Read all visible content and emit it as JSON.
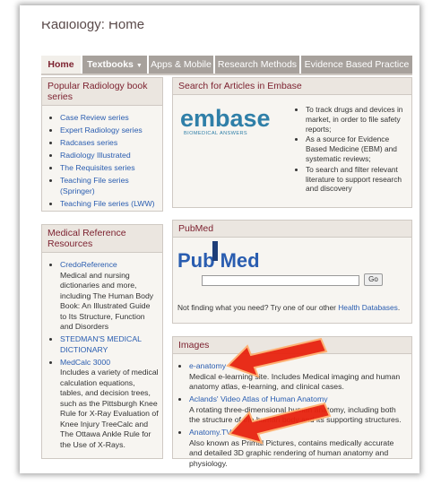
{
  "page": {
    "title": "Radiology: Home"
  },
  "tabs": [
    {
      "label": "Home",
      "active": true
    },
    {
      "label": "Textbooks",
      "dropdown": true
    },
    {
      "label": "Apps & Mobile"
    },
    {
      "label": "Research Methods"
    },
    {
      "label": "Evidence Based Practice"
    }
  ],
  "books": {
    "title": "Popular Radiology book series",
    "items": [
      "Case Review series",
      "Expert Radiology series",
      "Radcases series",
      "Radiology Illustrated",
      "The Requisites series",
      "Teaching File series (Springer)",
      "Teaching File series (LWW)"
    ]
  },
  "reference": {
    "title": "Medical Reference Resources",
    "items": [
      {
        "link": "CredoReference",
        "desc": "Medical and nursing dictionaries and more, including The Human Body Book: An Illustrated Guide to Its Structure, Function and Disorders"
      },
      {
        "link": "STEDMAN'S MEDICAL DICTIONARY",
        "desc": ""
      },
      {
        "link": "MedCalc 3000",
        "desc": "Includes a variety of medical calculation equations, tables, and decision trees, such as the Pittsburgh Knee Rule for X-Ray Evaluation of Knee Injury TreeCalc and The Ottawa Ankle Rule for the Use of X-Rays."
      }
    ]
  },
  "embase": {
    "title": "Search for Articles in Embase",
    "logo_word": "embase",
    "logo_sub": "BIOMEDICAL ANSWERS",
    "points": [
      "To track drugs and devices in market, in order to file safety reports;",
      "As a source for Evidence Based Medicine (EBM) and systematic reviews;",
      "To search and filter relevant literature to support research and discovery"
    ]
  },
  "pubmed": {
    "title": "PubMed",
    "logo_pub": "Pub",
    "logo_med": "Med",
    "go_label": "Go",
    "note_prefix": "Not finding what you need? Try one of our other ",
    "note_link": "Health Databases",
    "note_suffix": "."
  },
  "images": {
    "title": "Images",
    "items": [
      {
        "link": "e-anatomy",
        "desc": "Medical e-learning site. Includes Medical imaging and human anatomy atlas, e-learning, and clinical cases."
      },
      {
        "link": "Aclands' Video Atlas of Human Anatomy",
        "desc": "A rotating three-dimensional human anatomy, including both the structure of the human body and its supporting structures."
      },
      {
        "link": "Anatomy.TV",
        "desc": "Also known as Primal Pictures, contains medically accurate and detailed 3D graphic rendering of human anatomy and physiology."
      }
    ]
  },
  "colors": {
    "accent": "#7d2230",
    "link": "#2a5db0",
    "arrow": "#e8230f",
    "tab": "#a7a19c"
  }
}
